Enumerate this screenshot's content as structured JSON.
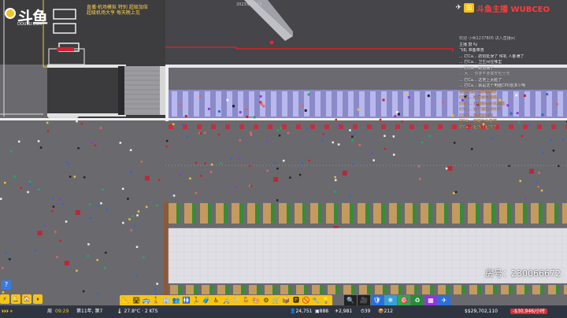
{
  "overlay": {
    "logo_text": "斗鱼",
    "logo_sub": "DOUYU.COM",
    "stream_title_line1": "直播·机场模拟 特别 超级加倍",
    "stream_title_line2": "超级机场大亨 每天晚上见",
    "top_center": "2023年6月13",
    "brand_badge": "国",
    "brand_name": "斗鱼主播 WUBCEO",
    "brand_plane": "✈",
    "room_number": "房号：230066672"
  },
  "chat": [
    {
      "text": "欢迎 小明1237B05 进入直播间",
      "style": "grey"
    },
    {
      "text": "主播 鼓 吗",
      "style": ""
    },
    {
      "text": "飞机  准备降落",
      "style": ""
    },
    {
      "text": "... 打Ca... 航班延误了  候机  人都满了",
      "style": ""
    },
    {
      "text": "... 打Ca... 卫生间在哪里",
      "style": ""
    },
    {
      "text": "... 打Ca... 跑道满了",
      "style": ""
    },
    {
      "text": "... 大 ... 你要不要做安检分流",
      "style": "grey"
    },
    {
      "text": "... 打Ca... 这地上太脏了",
      "style": ""
    },
    {
      "text": "... 打Ca... 就是这个电脑CPU很多少啊",
      "style": ""
    },
    {
      "text": "支持主播 一起玩游戏",
      "style": "orange"
    },
    {
      "text": "打Ca... 好厉害的游戏",
      "style": "orange"
    },
    {
      "text": "打Ca... 主播在玩什么游戏",
      "style": "orange"
    },
    {
      "text": "打Ca... 这个游戏叫什么",
      "style": "orange"
    },
    {
      "text": "打Ca... 游戏好玩吗",
      "style": "orange"
    },
    {
      "text": "打Ca... 这是什么机场",
      "style": "orange"
    },
    {
      "text": "打Ca... 起飞了起飞了",
      "style": "orange"
    }
  ],
  "status_bar": {
    "day_label": "周",
    "time": "09:29",
    "date": "第11年, 第7",
    "weather": "27.8°C · 2 KTS",
    "stat1": "24,751",
    "stat2": "888",
    "stat3": "2,981",
    "stat4": "39",
    "stat5": "212",
    "money": "$29,702,110",
    "money_rate": "-$30,946/小时"
  },
  "toolbar_icons": [
    "📐",
    "🛣",
    "🚌",
    "🚶",
    "🏢",
    "👥",
    "🚻",
    "🏃",
    "🧳",
    "♿",
    "🚕",
    "🍴",
    "🪑",
    "🎨",
    "⚙",
    "🛒",
    "📦",
    "🅿",
    "🚫",
    "🔧",
    "💡"
  ],
  "toolbar2_icons": [
    "🔍",
    "🎥",
    "🛡",
    "❄",
    "🎯",
    "♻",
    "▦",
    "✈"
  ],
  "left_ctrl": [
    "⚡",
    "🔔",
    "🏠",
    "⏸"
  ],
  "help_label": "?",
  "colors": {
    "floor": "#6b6b6f",
    "tarmac": "#3f3f42",
    "terminal_floor": "#dcdce2",
    "stripe_blue": "#a9a9e6",
    "hazard": "#c8a060",
    "queue_green": "#3a8a3a",
    "accent_yellow": "#f5c518"
  }
}
